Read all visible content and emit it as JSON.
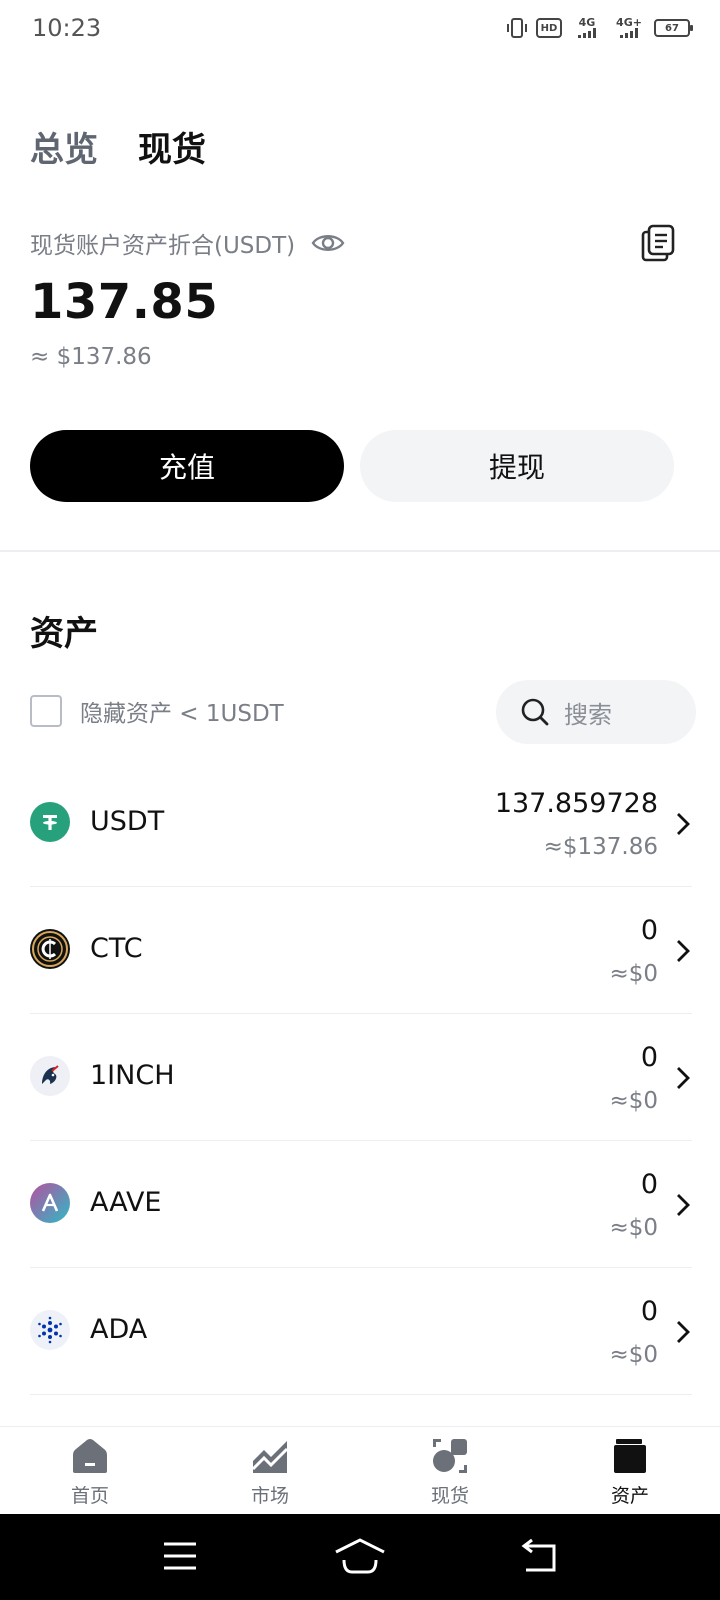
{
  "status_bar": {
    "time": "10:23",
    "hd": "HD",
    "net1": "4G",
    "net2": "4G+",
    "battery": "67"
  },
  "top_tabs": [
    {
      "label": "总览",
      "active": false
    },
    {
      "label": "现货",
      "active": true
    }
  ],
  "account": {
    "label": "现货账户资产折合(USDT)",
    "total": "137.85",
    "usd_approx": "≈ $137.86"
  },
  "actions": {
    "deposit_label": "充值",
    "withdraw_label": "提现"
  },
  "assets": {
    "title": "资产",
    "hide_small_label": "隐藏资产 < 1USDT",
    "hide_small_checked": false,
    "search_placeholder": "搜索",
    "items": [
      {
        "symbol": "USDT",
        "amount": "137.859728",
        "value": "≈$137.86",
        "icon": "usdt-icon",
        "color": "#26a17b"
      },
      {
        "symbol": "CTC",
        "amount": "0",
        "value": "≈$0",
        "icon": "ctc-icon",
        "color": "#111111"
      },
      {
        "symbol": "1INCH",
        "amount": "0",
        "value": "≈$0",
        "icon": "1inch-icon",
        "color": "#1b314f"
      },
      {
        "symbol": "AAVE",
        "amount": "0",
        "value": "≈$0",
        "icon": "aave-icon",
        "color": "#7b5bd6"
      },
      {
        "symbol": "ADA",
        "amount": "0",
        "value": "≈$0",
        "icon": "ada-icon",
        "color": "#0033ad"
      }
    ]
  },
  "bottom_nav": [
    {
      "label": "首页",
      "icon": "home-icon",
      "active": false
    },
    {
      "label": "市场",
      "icon": "market-chart-icon",
      "active": false
    },
    {
      "label": "现货",
      "icon": "spot-trade-icon",
      "active": false
    },
    {
      "label": "资产",
      "icon": "wallet-icon",
      "active": true
    }
  ]
}
